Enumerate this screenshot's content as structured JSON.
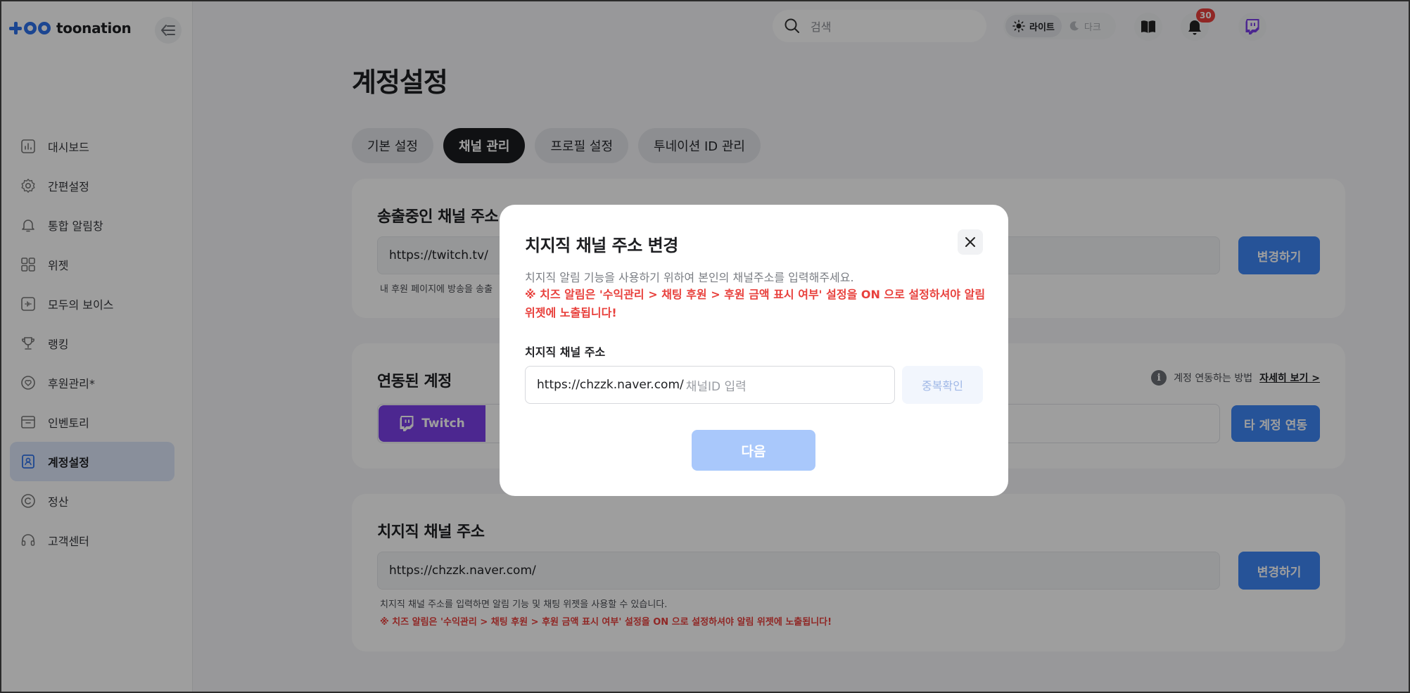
{
  "brand": {
    "name": "toonation",
    "accent": "#2e72ea"
  },
  "sidebar": {
    "items": [
      {
        "label": "대시보드",
        "icon": "dashboard-icon"
      },
      {
        "label": "간편설정",
        "icon": "gear-icon"
      },
      {
        "label": "통합 알림창",
        "icon": "bell-icon"
      },
      {
        "label": "위젯",
        "icon": "widget-grid-icon"
      },
      {
        "label": "모두의 보이스",
        "icon": "voice-icon"
      },
      {
        "label": "랭킹",
        "icon": "trophy-icon"
      },
      {
        "label": "후원관리*",
        "icon": "heart-icon"
      },
      {
        "label": "인벤토리",
        "icon": "inventory-icon"
      },
      {
        "label": "계정설정",
        "icon": "account-icon",
        "active": true
      },
      {
        "label": "정산",
        "icon": "copyright-icon"
      },
      {
        "label": "고객센터",
        "icon": "headset-icon"
      }
    ]
  },
  "topbar": {
    "search_placeholder": "검색",
    "theme_light": "라이트",
    "theme_dark": "다크",
    "notification_count": "30"
  },
  "page": {
    "title": "계정설정",
    "tabs": [
      "기본 설정",
      "채널 관리",
      "프로필 설정",
      "투네이션 ID 관리"
    ],
    "active_tab": "채널 관리"
  },
  "broadcast_card": {
    "title": "송출중인 채널 주소",
    "field_value": "https://twitch.tv/",
    "button": "변경하기",
    "hint": "내 후원 페이지에 방송을 송출"
  },
  "linked_card": {
    "title": "연동된 계정",
    "help_text": "계정 연동하는 방법",
    "help_link": "자세히 보기 >",
    "twitch_label": "Twitch",
    "twitch_color": "#7b3fe8",
    "button": "타 계정 연동"
  },
  "chzzk_card": {
    "title": "치지직 채널 주소",
    "field_value": "https://chzzk.naver.com/",
    "button": "변경하기",
    "hint": "치지직 채널 주소를 입력하면 알림 기능 및 채팅 위젯을 사용할 수 있습니다.",
    "warning": "※ 치즈 알림은 '수익관리 > 채팅 후원 > 후원 금액 표시 여부' 설정을 ON 으로 설정하셔야 알림 위젯에 노출됩니다!"
  },
  "modal": {
    "title": "치지직 채널 주소 변경",
    "description": "치지직 알림 기능을 사용하기 위하여 본인의 채널주소를 입력해주세요.",
    "warning": "※ 치즈 알림은 '수익관리 > 채팅 후원 > 후원 금액 표시 여부' 설정을 ON 으로 설정하셔야 알림 위젯에 노출됩니다!",
    "field_label": "치지직 채널 주소",
    "input_prefix": "https://chzzk.naver.com/",
    "input_placeholder": "채널ID 입력",
    "dup_check_button": "중복확인",
    "next_button": "다음"
  }
}
